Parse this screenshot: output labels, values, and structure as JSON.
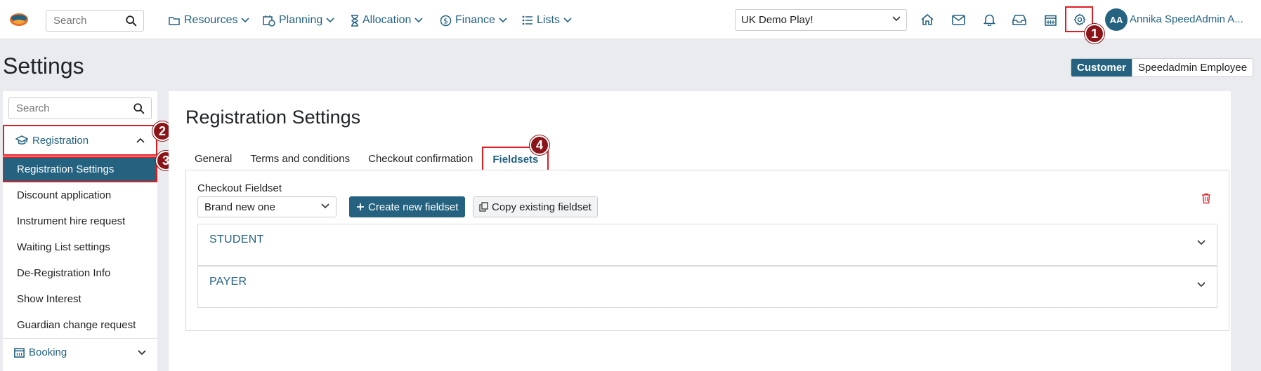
{
  "topbar": {
    "search_placeholder": "Search",
    "nav": [
      {
        "label": "Resources",
        "icon": "folder-icon"
      },
      {
        "label": "Planning",
        "icon": "calendar-clock-icon"
      },
      {
        "label": "Allocation",
        "icon": "hourglass-icon"
      },
      {
        "label": "Finance",
        "icon": "dollar-circle-icon"
      },
      {
        "label": "Lists",
        "icon": "list-icon"
      }
    ],
    "org_select_value": "UK Demo Play!",
    "tools": [
      "home-icon",
      "mail-icon",
      "bell-icon",
      "inbox-icon",
      "calendar-icon",
      "gear-icon"
    ],
    "user_initials": "AA",
    "user_name": "Annika SpeedAdmin A..."
  },
  "badges": [
    "1",
    "2",
    "3",
    "4"
  ],
  "page": {
    "title": "Settings",
    "role_active": "Customer",
    "role_inactive": "Speedadmin Employee"
  },
  "sidebar": {
    "search_placeholder": "Search",
    "group_registration": "Registration",
    "items": [
      "Registration Settings",
      "Discount application",
      "Instrument hire request",
      "Waiting List settings",
      "De-Registration Info",
      "Show Interest",
      "Guardian change request"
    ],
    "group_booking": "Booking"
  },
  "main": {
    "title": "Registration Settings",
    "tabs": [
      "General",
      "Terms and conditions",
      "Checkout confirmation",
      "Fieldsets"
    ],
    "fieldset_label": "Checkout Fieldset",
    "fieldset_value": "Brand new one",
    "create_button": "Create new fieldset",
    "copy_button": "Copy existing fieldset",
    "sections": [
      "STUDENT",
      "PAYER"
    ]
  },
  "colors": {
    "brand": "#246280",
    "highlight": "#e11b22",
    "badge": "#8b1418",
    "danger": "#d9363e"
  }
}
